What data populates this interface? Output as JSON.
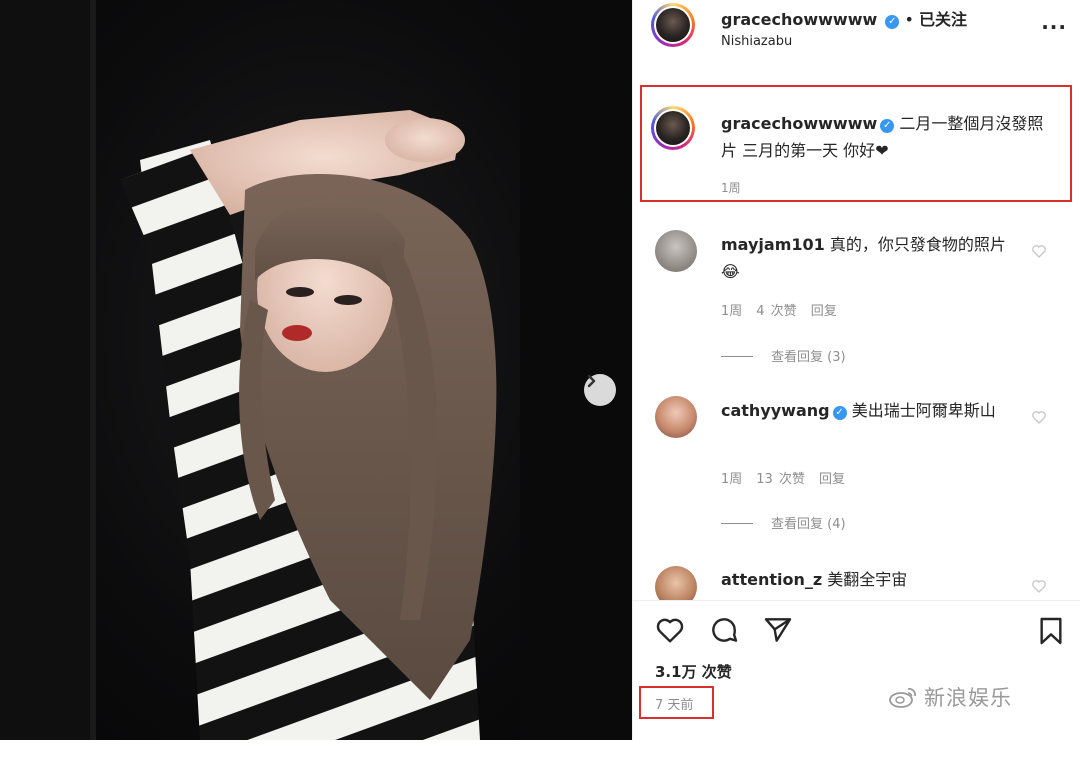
{
  "post": {
    "username": "gracechowwwww",
    "verified_icon": "verified-badge-icon",
    "separator": "•",
    "follow_status": "已关注",
    "location": "Nishiazabu",
    "more_label": "..."
  },
  "caption": {
    "username": "gracechowwwww",
    "text": "二月一整個月沒發照片 三月的第一天 你好",
    "heart": "❤",
    "time": "1周"
  },
  "comments": [
    {
      "username": "mayjam101",
      "verified": false,
      "text": "真的，你只發食物的照片😂",
      "time": "1周",
      "likes": "4 次赞",
      "reply": "回复",
      "view_replies": "查看回复 (3)"
    },
    {
      "username": "cathyywang",
      "verified": true,
      "text": "美出瑞士阿爾卑斯山",
      "time": "1周",
      "likes": "13 次赞",
      "reply": "回复",
      "view_replies": "查看回复 (4)"
    },
    {
      "username": "attention_z",
      "verified": false,
      "text": "美翻全宇宙"
    }
  ],
  "actions": {
    "like_icon": "heart-icon",
    "comment_icon": "comment-icon",
    "share_icon": "send-icon",
    "save_icon": "bookmark-icon"
  },
  "likes_count": "3.1万 次赞",
  "time_ago": "7 天前",
  "watermark": "新浪娱乐",
  "colors": {
    "highlight": "#d9302c",
    "verified": "#3897f0",
    "muted": "#8e8e8e"
  }
}
